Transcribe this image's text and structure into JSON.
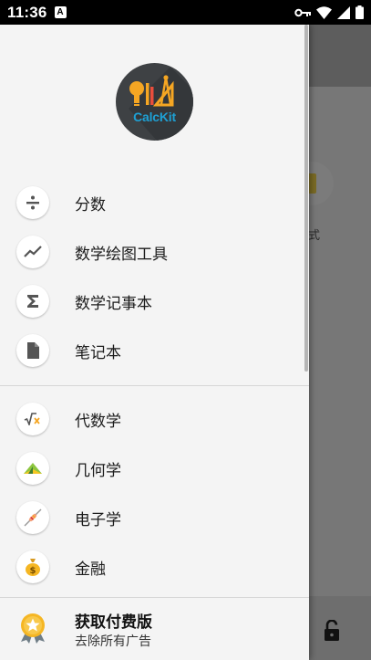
{
  "status_bar": {
    "time": "11:36",
    "notification_letter": "A"
  },
  "logo": {
    "text": "CalcKit"
  },
  "background": {
    "partial_label": "式"
  },
  "drawer": {
    "items_top": [
      {
        "label": "分数",
        "icon": "divide-icon"
      },
      {
        "label": "数学绘图工具",
        "icon": "graph-line-icon"
      },
      {
        "label": "数学记事本",
        "icon": "sigma-icon"
      },
      {
        "label": "笔记本",
        "icon": "document-icon"
      }
    ],
    "items_bottom": [
      {
        "label": "代数学",
        "icon": "square-root-icon"
      },
      {
        "label": "几何学",
        "icon": "triangle-ruler-icon"
      },
      {
        "label": "电子学",
        "icon": "resistor-icon"
      },
      {
        "label": "金融",
        "icon": "money-bag-icon"
      }
    ],
    "premium": {
      "title": "获取付费版",
      "subtitle": "去除所有广告",
      "icon": "medal-star-icon"
    }
  },
  "colors": {
    "drawer_bg": "#f4f4f4",
    "logo_bg": "#3e4144",
    "logo_text": "#1ea0d4",
    "accent_orange": "#f5a623"
  }
}
